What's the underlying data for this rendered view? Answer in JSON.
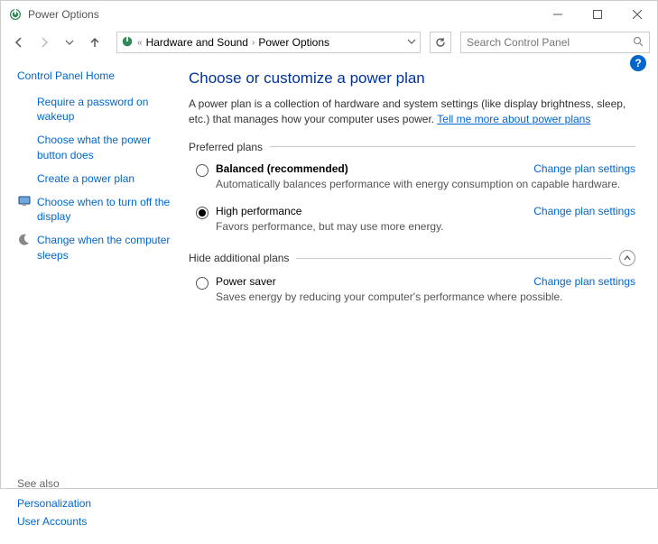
{
  "window": {
    "title": "Power Options"
  },
  "breadcrumb": {
    "sep": "«",
    "items": [
      "Hardware and Sound",
      "Power Options"
    ]
  },
  "search": {
    "placeholder": "Search Control Panel"
  },
  "sidebar": {
    "home": "Control Panel Home",
    "links": [
      {
        "label": "Require a password on wakeup",
        "icon": ""
      },
      {
        "label": "Choose what the power button does",
        "icon": ""
      },
      {
        "label": "Create a power plan",
        "icon": ""
      },
      {
        "label": "Choose when to turn off the display",
        "icon": "monitor-icon"
      },
      {
        "label": "Change when the computer sleeps",
        "icon": "moon-icon"
      }
    ]
  },
  "seealso": {
    "header": "See also",
    "links": [
      "Personalization",
      "User Accounts"
    ]
  },
  "main": {
    "heading": "Choose or customize a power plan",
    "intro": "A power plan is a collection of hardware and system settings (like display brightness, sleep, etc.) that manages how your computer uses power. ",
    "tellme": "Tell me more about power plans",
    "preferred_header": "Preferred plans",
    "hidden_header": "Hide additional plans",
    "change_label": "Change plan settings",
    "plans_preferred": [
      {
        "name": "Balanced (recommended)",
        "desc": "Automatically balances performance with energy consumption on capable hardware.",
        "selected": false,
        "bold": true
      },
      {
        "name": "High performance",
        "desc": "Favors performance, but may use more energy.",
        "selected": true,
        "bold": false
      }
    ],
    "plans_hidden": [
      {
        "name": "Power saver",
        "desc": "Saves energy by reducing your computer's performance where possible.",
        "selected": false,
        "bold": false
      }
    ]
  }
}
